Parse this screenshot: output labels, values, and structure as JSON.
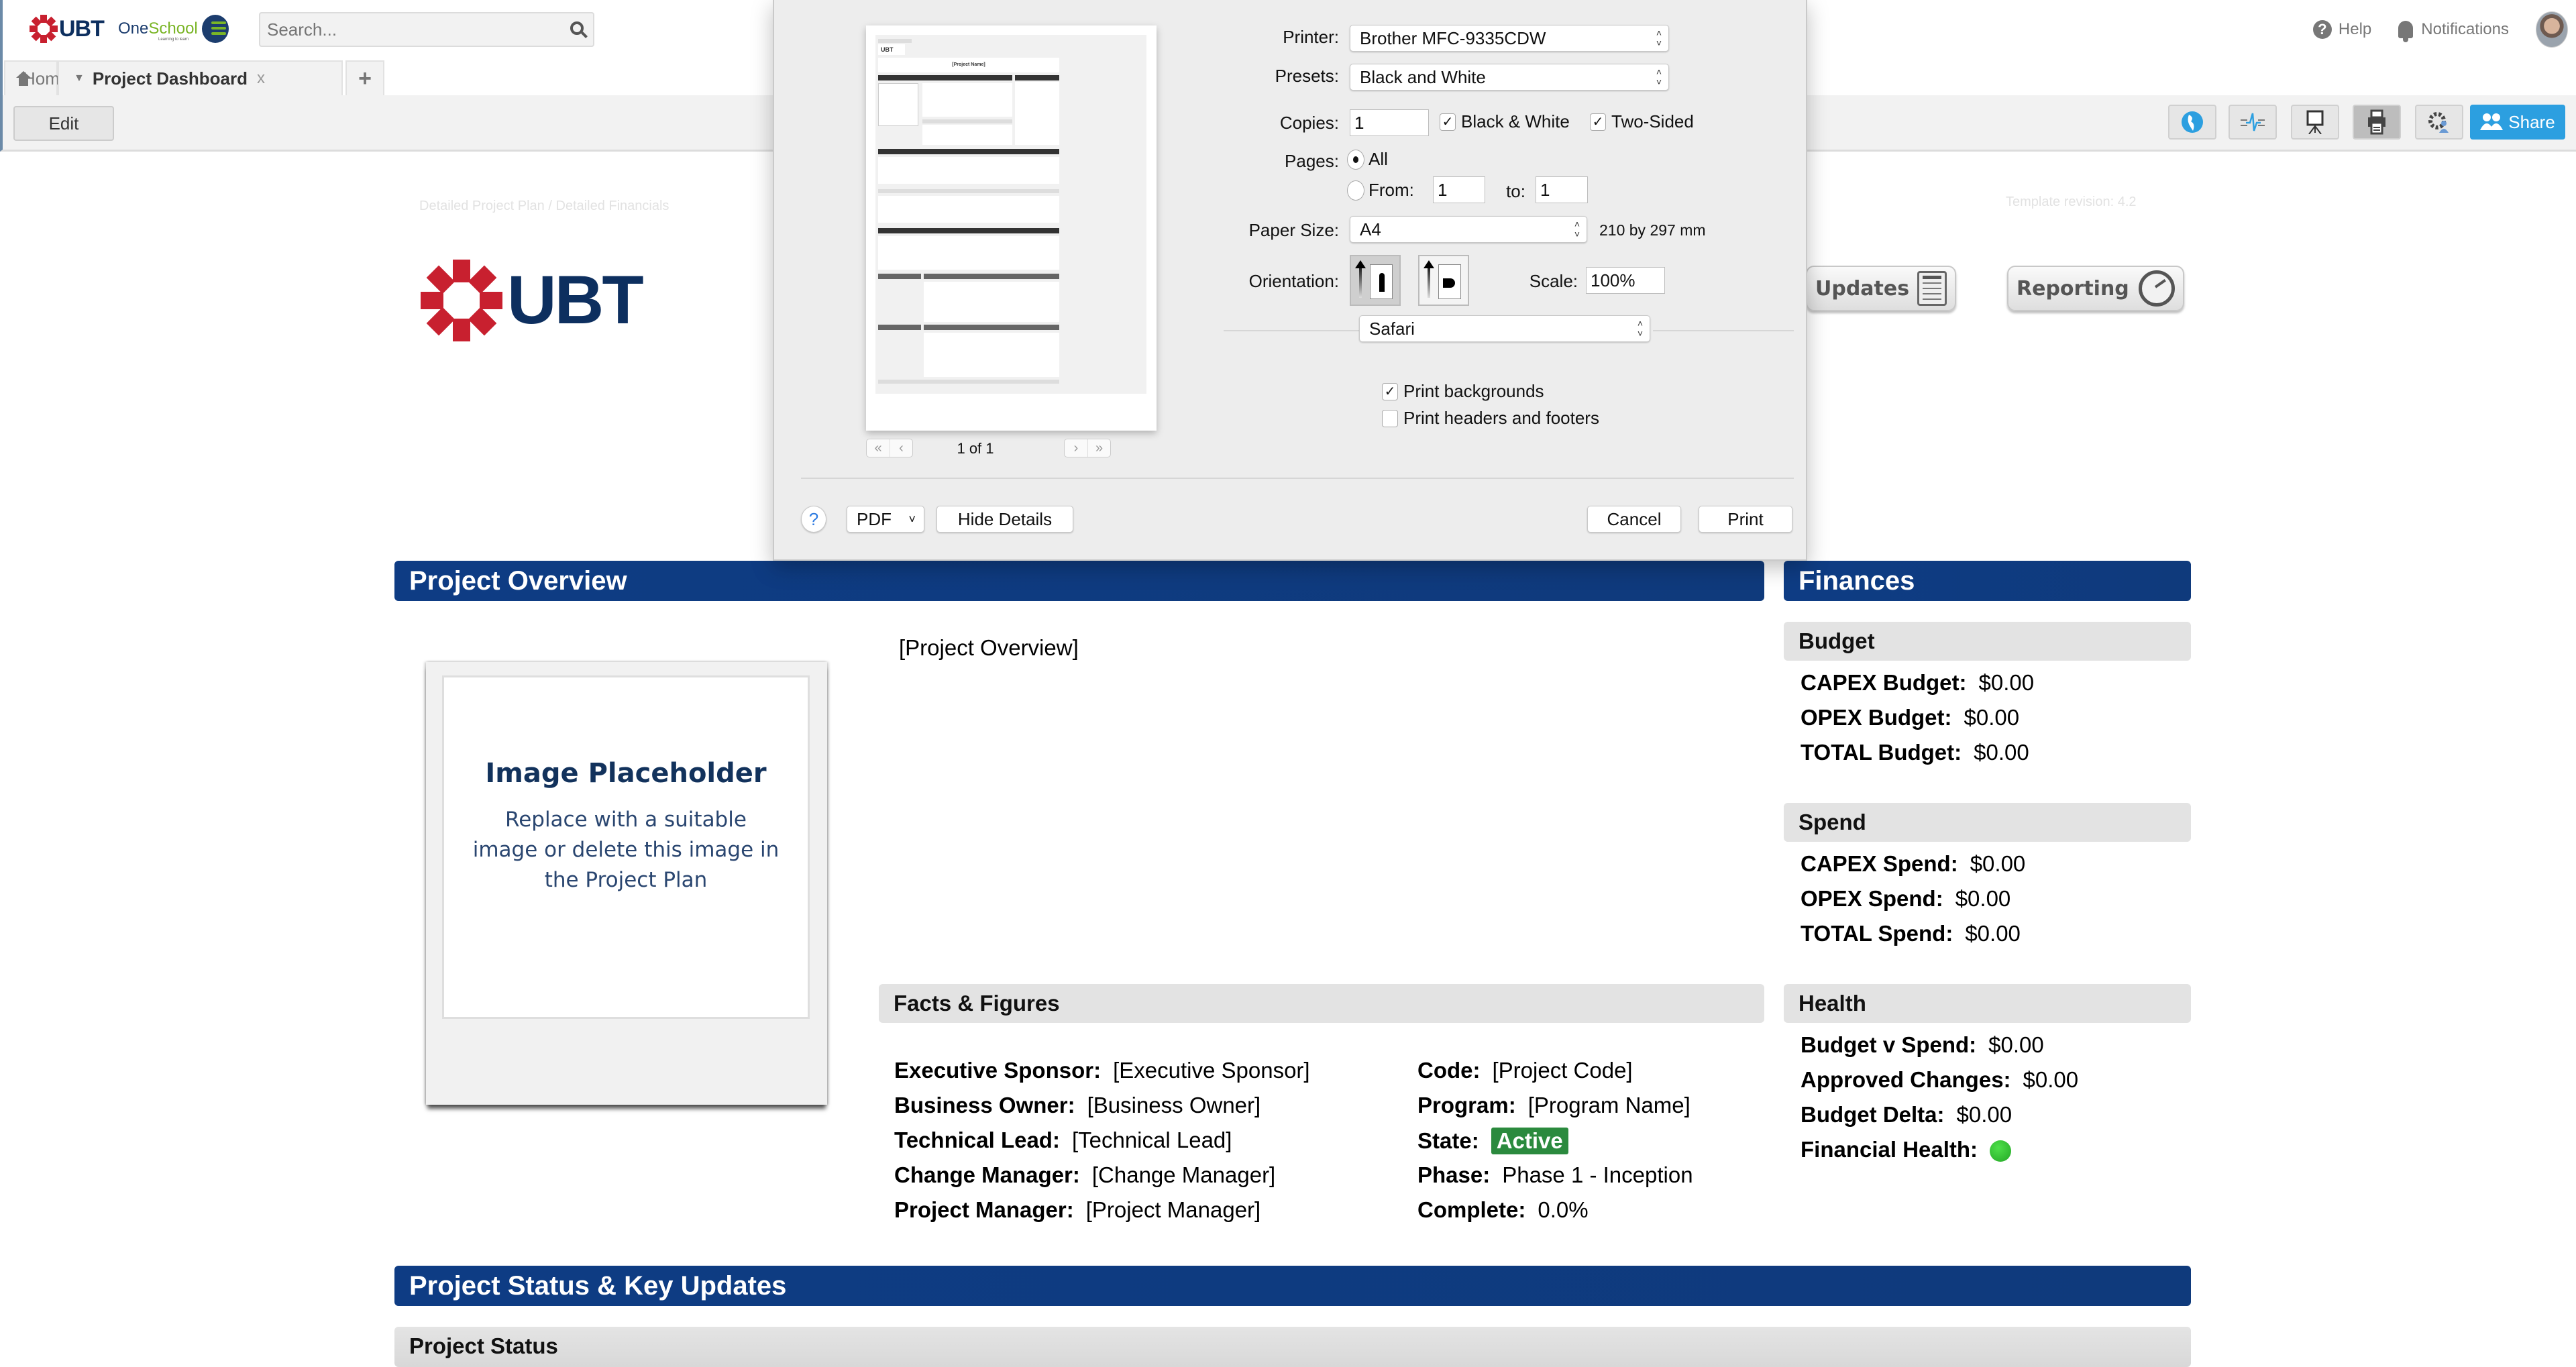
{
  "topbar": {
    "brand_logo": "UBT",
    "product_logo_one": "One",
    "product_logo_school": "School",
    "product_tagline": "Learning to learn",
    "search_placeholder": "Search...",
    "help_label": "Help",
    "notifications_label": "Notifications"
  },
  "tabs": [
    {
      "label": "Home",
      "icon": "home-icon"
    },
    {
      "label": "Project Dashboard",
      "active": true,
      "close": "x"
    },
    {
      "label": "+"
    }
  ],
  "toolbar": {
    "edit_label": "Edit",
    "tools": [
      "globe-icon",
      "activity-icon",
      "presentation-icon",
      "print-icon",
      "settings-user-icon"
    ],
    "share_label": "Share",
    "share_color": "#2c9fe0"
  },
  "page": {
    "breadcrumb": "Detailed Project Plan / Detailed Financials",
    "template_revision": "Template revision: 4.2",
    "logo_text": "UBT",
    "nav_buttons": [
      {
        "label": "Updates",
        "icon": "document-icon"
      },
      {
        "label": "Reporting",
        "icon": "gauge-icon"
      }
    ],
    "header_color": "#0e3c84",
    "project_overview": {
      "title": "Project Overview",
      "image_placeholder_title": "Image Placeholder",
      "image_placeholder_text": "Replace with a suitable image or delete this image in the Project Plan",
      "overview_text": "[Project Overview]"
    },
    "facts": {
      "title": "Facts & Figures",
      "left": [
        {
          "label": "Executive Sponsor:",
          "value": "[Executive Sponsor]"
        },
        {
          "label": "Business Owner:",
          "value": "[Business Owner]"
        },
        {
          "label": "Technical Lead:",
          "value": "[Technical Lead]"
        },
        {
          "label": "Change Manager:",
          "value": "[Change Manager]"
        },
        {
          "label": "Project Manager:",
          "value": "[Project Manager]"
        }
      ],
      "right": [
        {
          "label": "Code:",
          "value": "[Project Code]"
        },
        {
          "label": "Program:",
          "value": "[Program Name]"
        },
        {
          "label": "State:",
          "value": "Active",
          "badge_color": "#2b8a3e"
        },
        {
          "label": "Phase:",
          "value": "Phase 1 - Inception"
        },
        {
          "label": "Complete:",
          "value": "0.0%"
        }
      ]
    },
    "finances": {
      "title": "Finances",
      "budget": {
        "title": "Budget",
        "rows": [
          {
            "label": "CAPEX Budget:",
            "value": "$0.00"
          },
          {
            "label": "OPEX Budget:",
            "value": "$0.00"
          },
          {
            "label": "TOTAL Budget:",
            "value": "$0.00"
          }
        ]
      },
      "spend": {
        "title": "Spend",
        "rows": [
          {
            "label": "CAPEX Spend:",
            "value": "$0.00"
          },
          {
            "label": "OPEX Spend:",
            "value": "$0.00"
          },
          {
            "label": "TOTAL Spend:",
            "value": "$0.00"
          }
        ]
      },
      "health": {
        "title": "Health",
        "rows": [
          {
            "label": "Budget v Spend:",
            "value": "$0.00"
          },
          {
            "label": "Approved Changes:",
            "value": "$0.00"
          },
          {
            "label": "Budget Delta:",
            "value": "$0.00"
          },
          {
            "label": "Financial Health:",
            "value": "green",
            "indicator_color": "#2fbf2f"
          }
        ]
      }
    },
    "status_section": {
      "title": "Project Status & Key Updates",
      "subtitle": "Project Status"
    }
  },
  "print_dialog": {
    "printer_label": "Printer:",
    "printer_value": "Brother MFC-9335CDW",
    "presets_label": "Presets:",
    "presets_value": "Black and White",
    "copies_label": "Copies:",
    "copies_value": "1",
    "black_white_label": "Black & White",
    "black_white_checked": true,
    "two_sided_label": "Two-Sided",
    "two_sided_checked": true,
    "pages_label": "Pages:",
    "pages_all_label": "All",
    "pages_all_selected": true,
    "pages_from_label": "From:",
    "pages_from_value": "1",
    "pages_to_label": "to:",
    "pages_to_value": "1",
    "paper_size_label": "Paper Size:",
    "paper_size_value": "A4",
    "paper_size_dims": "210 by 297 mm",
    "orientation_label": "Orientation:",
    "orientation_selected": "portrait",
    "scale_label": "Scale:",
    "scale_value": "100%",
    "section_select": "Safari",
    "print_backgrounds_label": "Print backgrounds",
    "print_backgrounds_checked": true,
    "print_headers_label": "Print headers and footers",
    "print_headers_checked": false,
    "page_indicator": "1 of 1",
    "help_label": "?",
    "pdf_label": "PDF",
    "hide_details_label": "Hide Details",
    "cancel_label": "Cancel",
    "print_label": "Print",
    "preview_title": "[Project Name]"
  }
}
